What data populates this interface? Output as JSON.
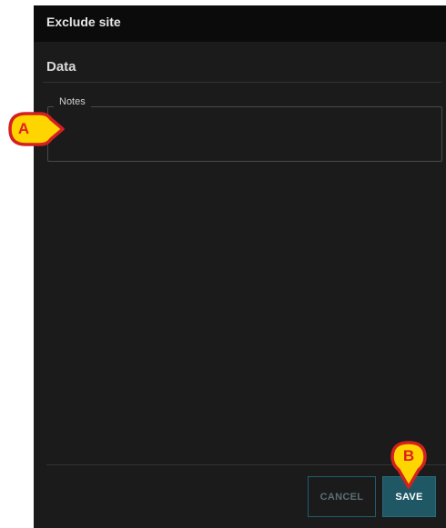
{
  "dialog": {
    "title": "Exclude site",
    "section_title": "Data",
    "notes": {
      "label": "Notes",
      "value": ""
    },
    "buttons": {
      "cancel_label": "CANCEL",
      "save_label": "SAVE"
    }
  },
  "annotations": {
    "marker_a": "A",
    "marker_b": "B"
  }
}
